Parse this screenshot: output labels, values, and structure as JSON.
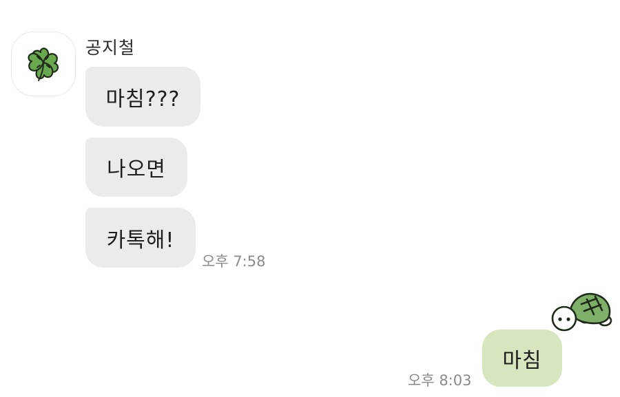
{
  "chat": {
    "contact": {
      "name": "공지철",
      "avatar_icon": "four-leaf-clover-icon"
    },
    "incoming": [
      {
        "text": "마침???"
      },
      {
        "text": "나오면"
      },
      {
        "text": "카톡해!"
      }
    ],
    "incoming_time": "오후 7:58",
    "outgoing": [
      {
        "text": "마침"
      }
    ],
    "outgoing_time": "오후 8:03",
    "outgoing_sticker_icon": "turtle-sticker-icon"
  },
  "colors": {
    "incoming_bubble": "#ebebeb",
    "outgoing_bubble": "#d7e6bf",
    "clover_green": "#6aa84f",
    "turtle_shell": "#7fb069"
  }
}
